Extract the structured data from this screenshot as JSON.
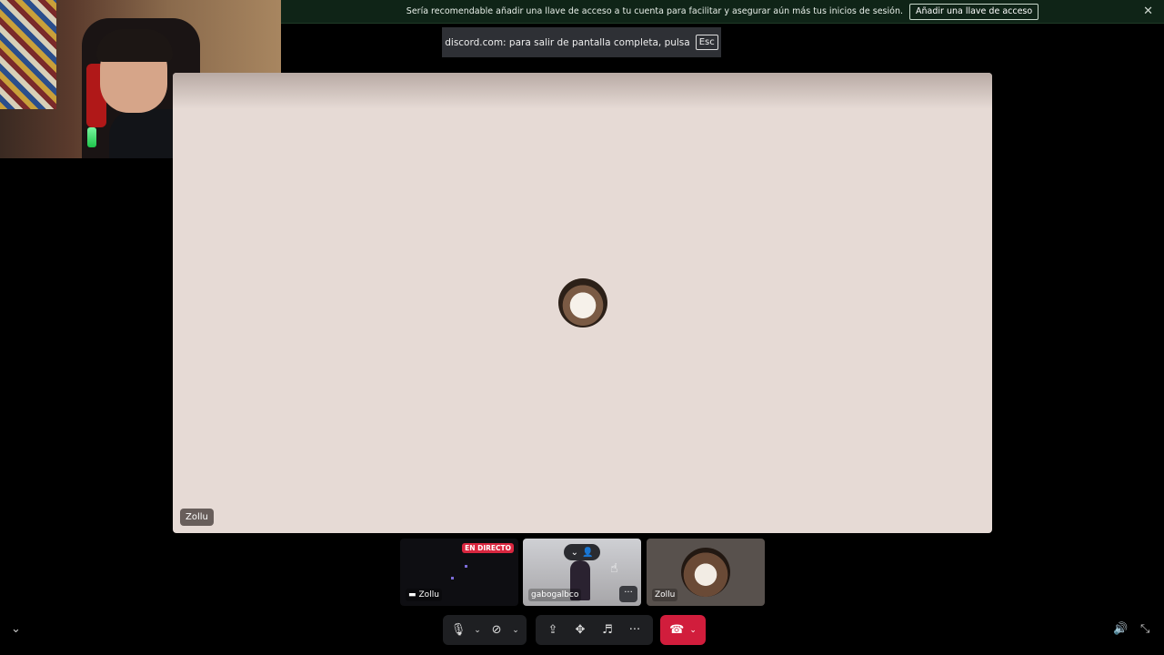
{
  "banner": {
    "message": "Sería recomendable añadir una llave de acceso a tu cuenta para facilitar y asegurar aún más tus inicios de sesión.",
    "action_label": "Añadir una llave de acceso",
    "close_symbol": "✕"
  },
  "toast": {
    "message": "discord.com: para salir de pantalla completa, pulsa",
    "key_label": "Esc"
  },
  "stage": {
    "participant_name": "Zollu"
  },
  "tiles": [
    {
      "label": "Zollu",
      "badge": "EN DIRECTO",
      "icon": "screen-share-icon"
    },
    {
      "label": "gabogalbco",
      "more_symbol": "···"
    },
    {
      "label": "Zollu"
    }
  ],
  "controls": {
    "mic_icon": "🎙",
    "caret": "⌄",
    "camera_icon": "⊘",
    "share_icon": "⇪",
    "activity_icon": "✥",
    "soundboard_icon": "♬",
    "more_icon": "···",
    "hangup_icon": "☎",
    "collapse_icon": "⌄",
    "volume_icon": "🔊",
    "exit_fullscreen_icon": "⤡"
  },
  "colors": {
    "banner_bg": "#0f2417",
    "stage_bg": "#e6dad5",
    "live_red": "#d9263f",
    "hangup_red": "#d11d3c"
  }
}
